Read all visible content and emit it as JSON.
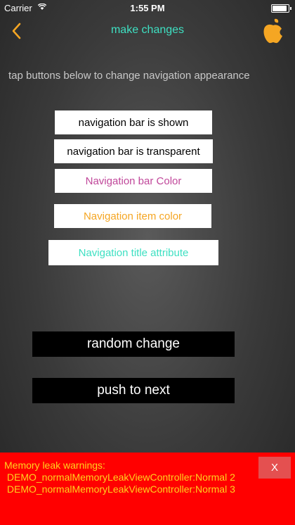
{
  "status_bar": {
    "carrier": "Carrier",
    "time": "1:55 PM",
    "battery_level": 1.0
  },
  "nav": {
    "title": "make changes",
    "title_color": "#3ee0c2",
    "back_icon": "chevron-left-icon",
    "back_color": "#f5a623",
    "right_icon": "apple-logo-icon",
    "right_color": "#f5a623"
  },
  "hint": "tap buttons below to change navigation appearance",
  "option_buttons": [
    {
      "label": "navigation bar is shown",
      "color": "#000000"
    },
    {
      "label": "navigation bar is transparent",
      "color": "#000000"
    },
    {
      "label": "Navigation bar Color",
      "color": "#c0479a"
    },
    {
      "label": "Navigation item color",
      "color": "#f5a623"
    },
    {
      "label": "Navigation title attribute",
      "color": "#3ee0c2"
    }
  ],
  "actions": {
    "random": "random change",
    "push": "push to next"
  },
  "warning": {
    "title": "Memory leak warnings:",
    "lines": [
      " DEMO_normalMemoryLeakViewController:Normal 2",
      " DEMO_normalMemoryLeakViewController:Normal 3"
    ],
    "close": "X",
    "background": "#ff0000",
    "text_color": "#ffd21e"
  }
}
